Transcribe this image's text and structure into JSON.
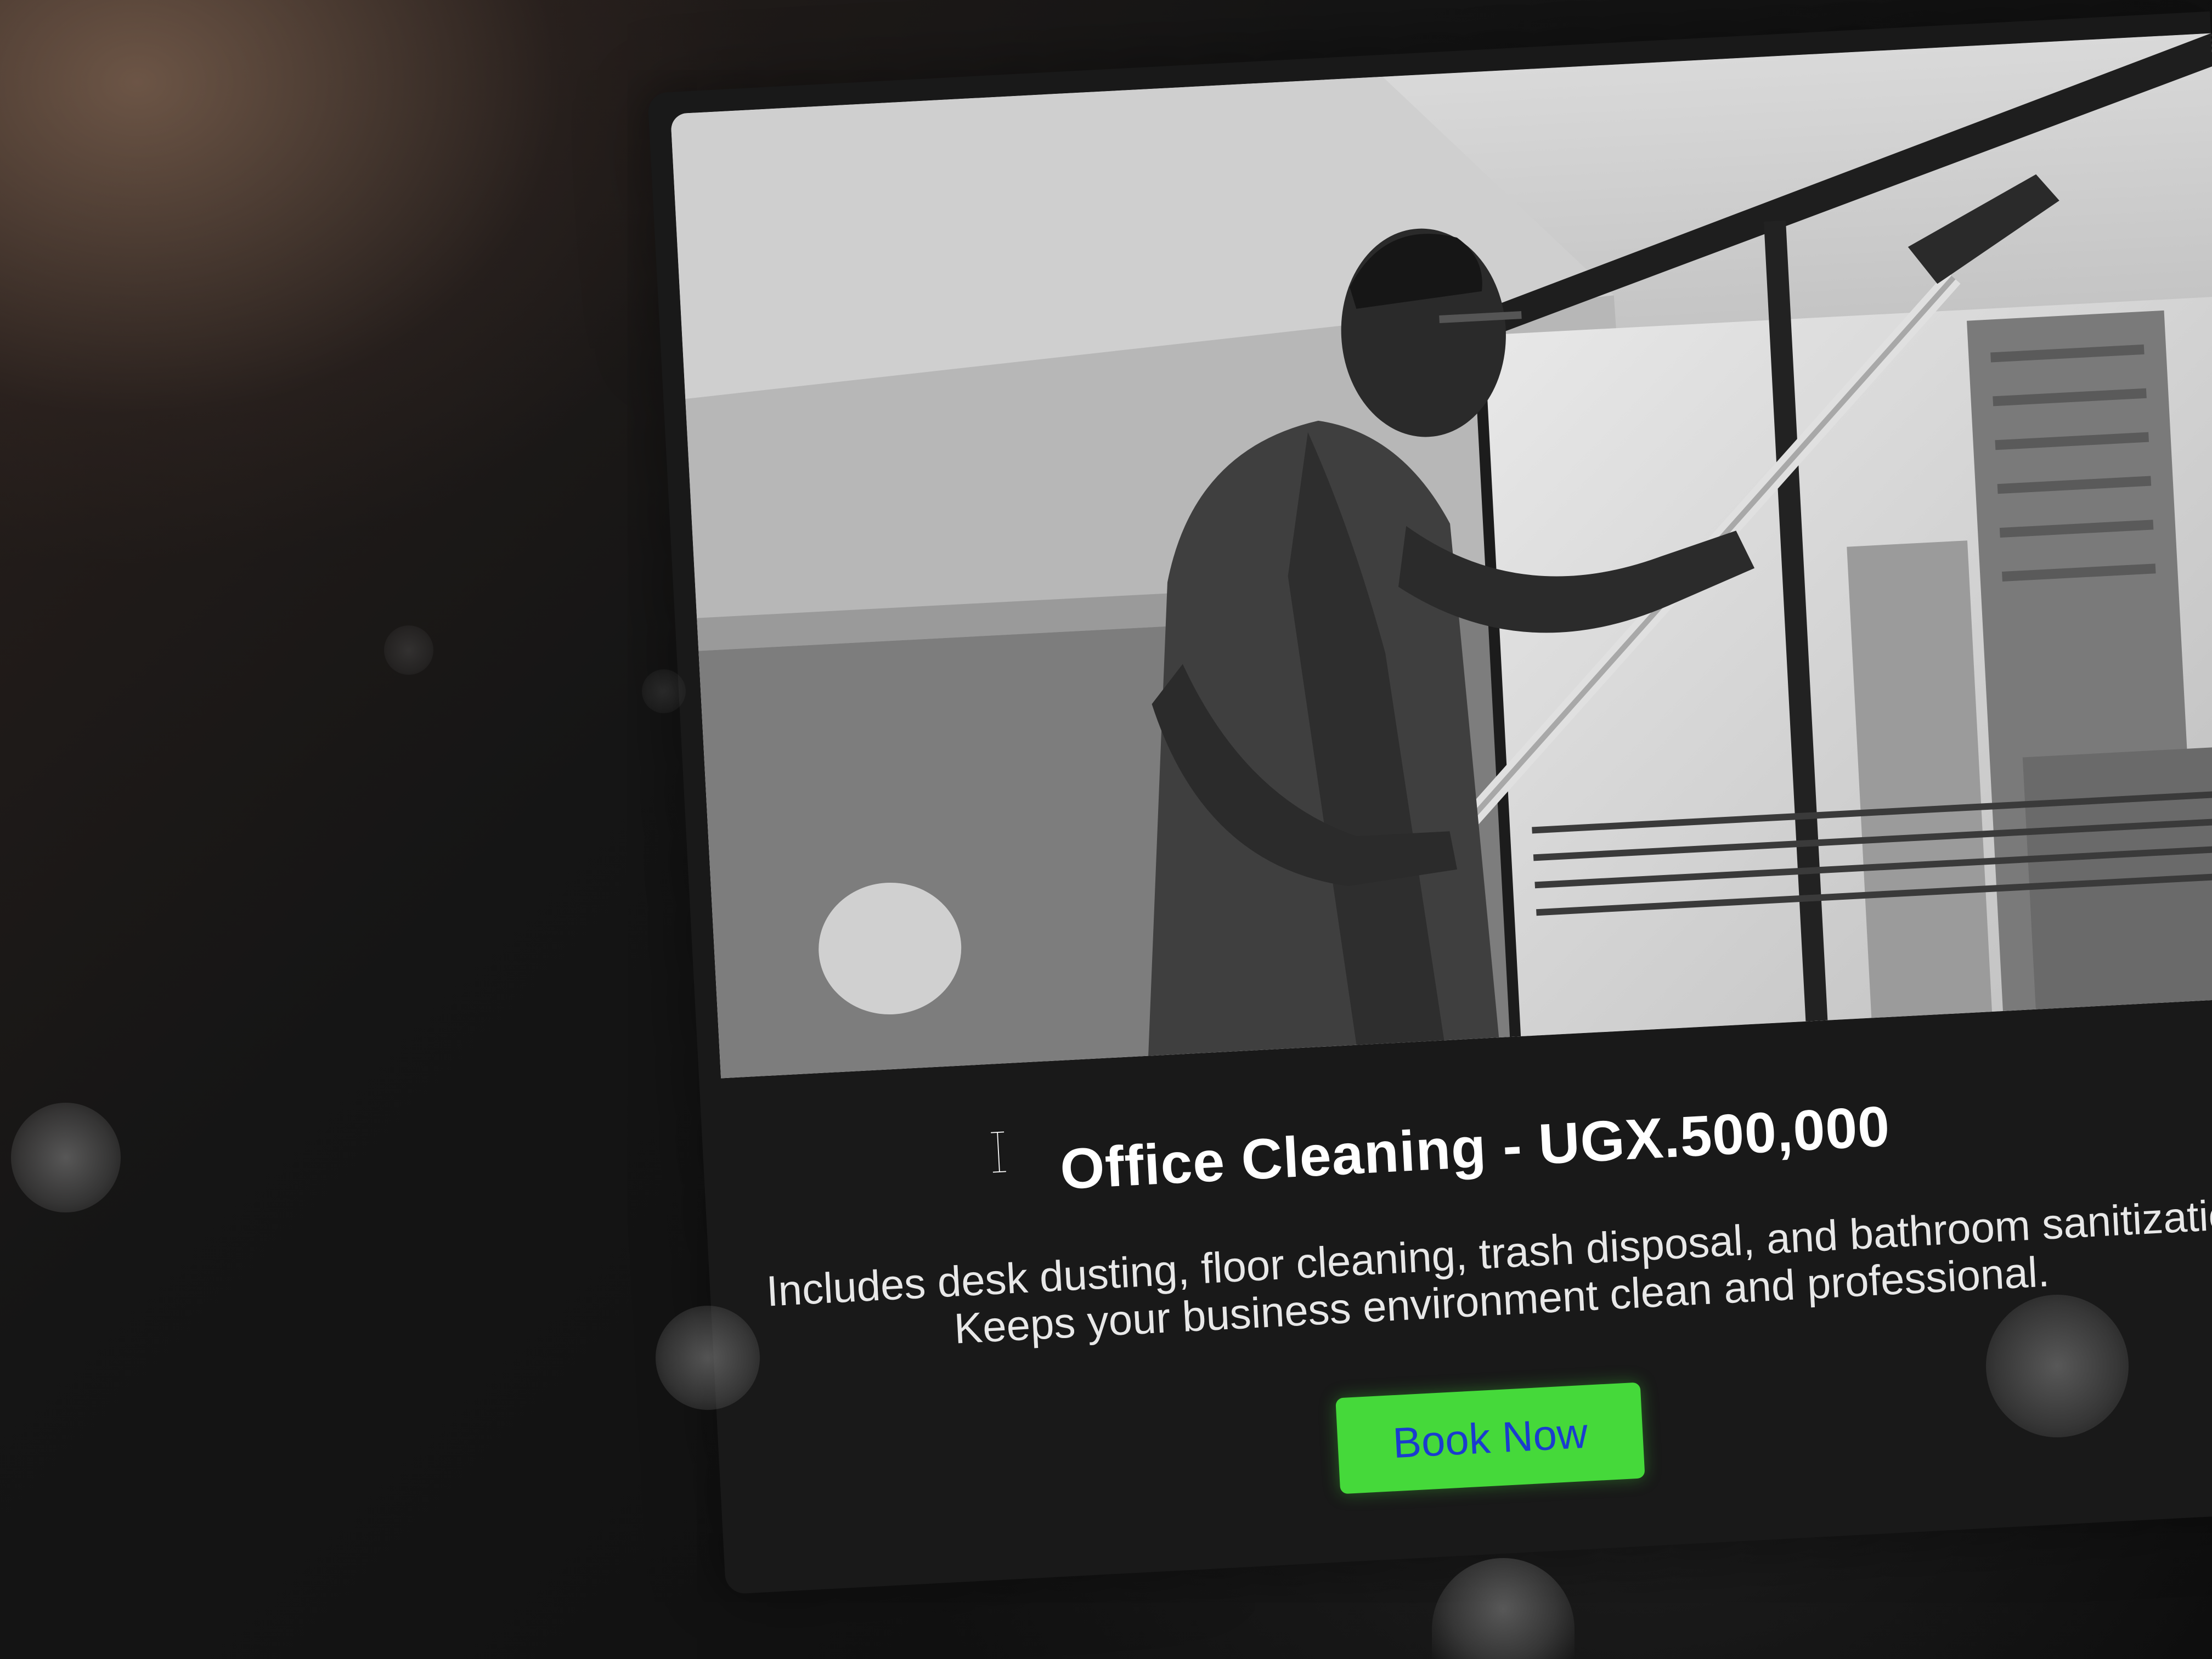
{
  "service_card": {
    "title": "Office Cleaning - UGX.500,000",
    "description_line_1": "Includes desk dusting, floor cleaning, trash disposal, and bathroom sanitizatio",
    "description_line_2": "Keeps your business environment clean and professional.",
    "button_label": "Book Now",
    "image_alt": "Man cleaning office window with a squeegee pole"
  },
  "colors": {
    "button_background": "#45d93a",
    "button_text": "#1a3ccf",
    "card_background": "#191919",
    "title_text": "#ffffff"
  },
  "icons": {
    "cursor": "text-cursor-icon"
  }
}
